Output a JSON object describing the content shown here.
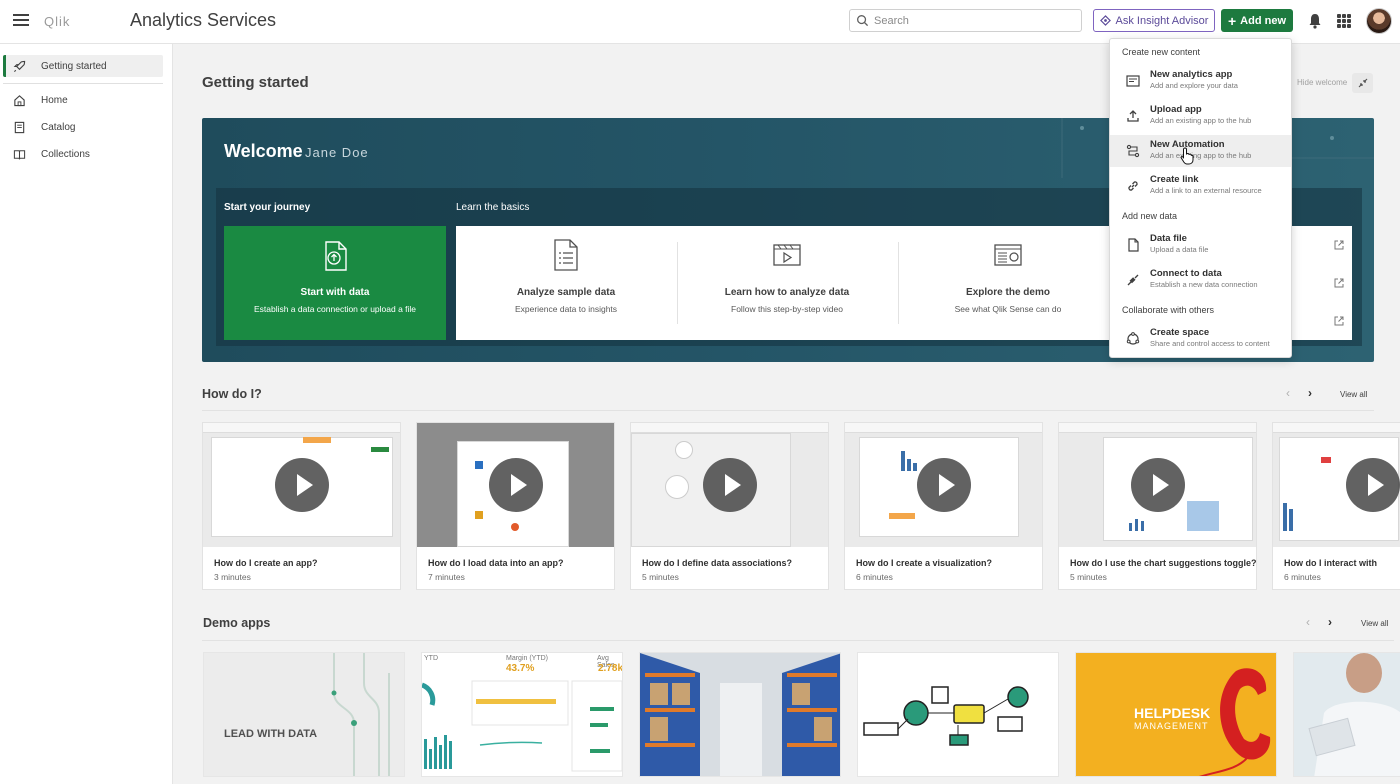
{
  "header": {
    "logo_text": "Qlik",
    "app_title": "Analytics Services",
    "search_placeholder": "Search",
    "ask_label": "Ask Insight Advisor",
    "add_new_label": "Add new"
  },
  "sidebar": {
    "items": [
      {
        "label": "Getting started",
        "icon": "rocket-icon",
        "active": true
      },
      {
        "label": "Home",
        "icon": "home-icon"
      },
      {
        "label": "Catalog",
        "icon": "catalog-icon"
      },
      {
        "label": "Collections",
        "icon": "collections-icon"
      }
    ]
  },
  "main": {
    "page_title": "Getting started",
    "hide_welcome": "Hide welcome",
    "welcome": {
      "title": "Welcome",
      "user_name": "Jane Doe",
      "start_label": "Start your journey",
      "learn_label": "Learn the basics",
      "start_card": {
        "title": "Start with data",
        "subtitle": "Establish a data connection or upload a file"
      },
      "learn_cards": [
        {
          "title": "Analyze sample data",
          "subtitle": "Experience data to insights"
        },
        {
          "title": "Learn how to analyze data",
          "subtitle": "Follow this step-by-step video"
        },
        {
          "title": "Explore the demo",
          "subtitle": "See what Qlik Sense can do"
        }
      ]
    },
    "how_do_i": {
      "title": "How do I?",
      "view_all": "View all",
      "videos": [
        {
          "title": "How do I create an app?",
          "duration": "3 minutes"
        },
        {
          "title": "How do I load data into an app?",
          "duration": "7 minutes"
        },
        {
          "title": "How do I define data associations?",
          "duration": "5 minutes"
        },
        {
          "title": "How do I create a visualization?",
          "duration": "6 minutes"
        },
        {
          "title": "How do I use the chart suggestions toggle?",
          "duration": "5 minutes"
        },
        {
          "title": "How do I interact with",
          "duration": "6 minutes"
        }
      ]
    },
    "demo_apps": {
      "title": "Demo apps",
      "view_all": "View all",
      "cards": [
        {
          "label": "LEAD WITH DATA"
        },
        {
          "label": "",
          "kpis": [
            "YTD",
            "Margin (YTD)",
            "Avg Sales",
            "43.7%",
            "2.78k"
          ]
        },
        {
          "label": ""
        },
        {
          "label": ""
        },
        {
          "label": "HELPDESK MANAGEMENT",
          "line1": "HELPDESK",
          "line2": "MANAGEMENT"
        },
        {
          "label": ""
        }
      ]
    }
  },
  "menu": {
    "section_create": "Create new content",
    "section_data": "Add new data",
    "section_collab": "Collaborate with others",
    "items": [
      {
        "title": "New analytics app",
        "subtitle": "Add and explore your data",
        "icon": "app-icon"
      },
      {
        "title": "Upload app",
        "subtitle": "Add an existing app to the hub",
        "icon": "upload-icon"
      },
      {
        "title": "New Automation",
        "subtitle": "Add an existing app to the hub",
        "icon": "automation-icon",
        "hover": true
      },
      {
        "title": "Create link",
        "subtitle": "Add a link to an external resource",
        "icon": "link-icon"
      },
      {
        "title": "Data file",
        "subtitle": "Upload a data file",
        "icon": "file-icon"
      },
      {
        "title": "Connect to data",
        "subtitle": "Establish a new data connection",
        "icon": "connect-icon"
      },
      {
        "title": "Create space",
        "subtitle": "Share and control access to content",
        "icon": "space-icon"
      }
    ]
  },
  "colors": {
    "accent_green": "#1d7a3f",
    "welcome_bg": "#245567",
    "insight_purple": "#7f64c0"
  }
}
